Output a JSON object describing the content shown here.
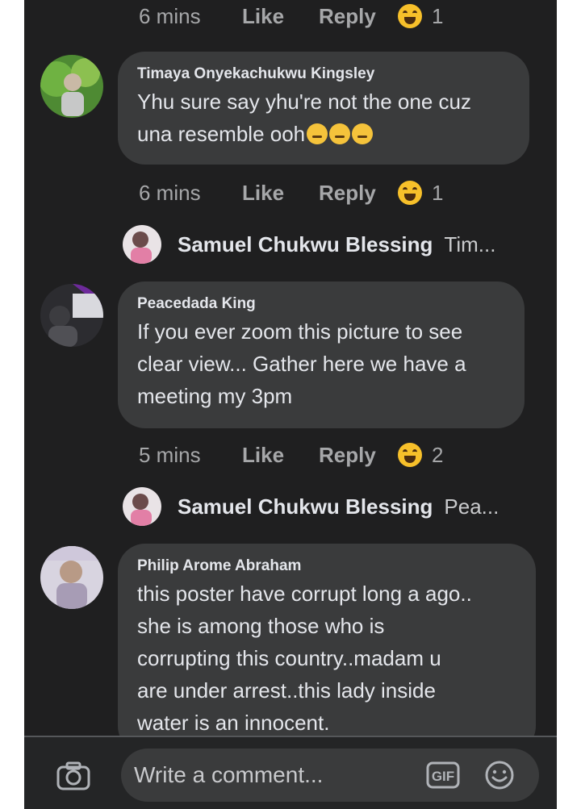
{
  "reply_label": "Reply",
  "like_label": "Like",
  "comments": [
    {
      "time": "6 mins",
      "reactions": "1"
    },
    {
      "author": "Timaya Onyekachukwu Kingsley",
      "lines": [
        "Yhu sure say yhu're not the one cuz",
        "una resemble ooh"
      ],
      "time": "6 mins",
      "reactions": "1",
      "reply_preview": {
        "author": "Samuel Chukwu Blessing",
        "text": "Tim..."
      }
    },
    {
      "author": "Peacedada King",
      "lines": [
        "If you ever zoom this picture to see",
        "clear view... Gather here we have a",
        "meeting my 3pm"
      ],
      "time": "5 mins",
      "reactions": "2",
      "reply_preview": {
        "author": "Samuel Chukwu Blessing",
        "text": "Pea..."
      }
    },
    {
      "author": "Philip Arome Abraham",
      "lines": [
        "this poster have corrupt long a ago..",
        "she is among those who is",
        "corrupting this country..madam u",
        "are under arrest..this lady inside",
        "water is an innocent."
      ]
    }
  ],
  "composer": {
    "placeholder": "Write a comment...",
    "gif_label": "GIF"
  },
  "colors": {
    "background": "#1f1f20",
    "bubble": "#3a3b3c",
    "text": "#e4e6eb",
    "muted": "#a6a7a9",
    "reaction": "#f7c02a"
  },
  "icons": [
    "haha-reaction-icon",
    "camera-icon",
    "gif-icon",
    "emoji-icon"
  ]
}
